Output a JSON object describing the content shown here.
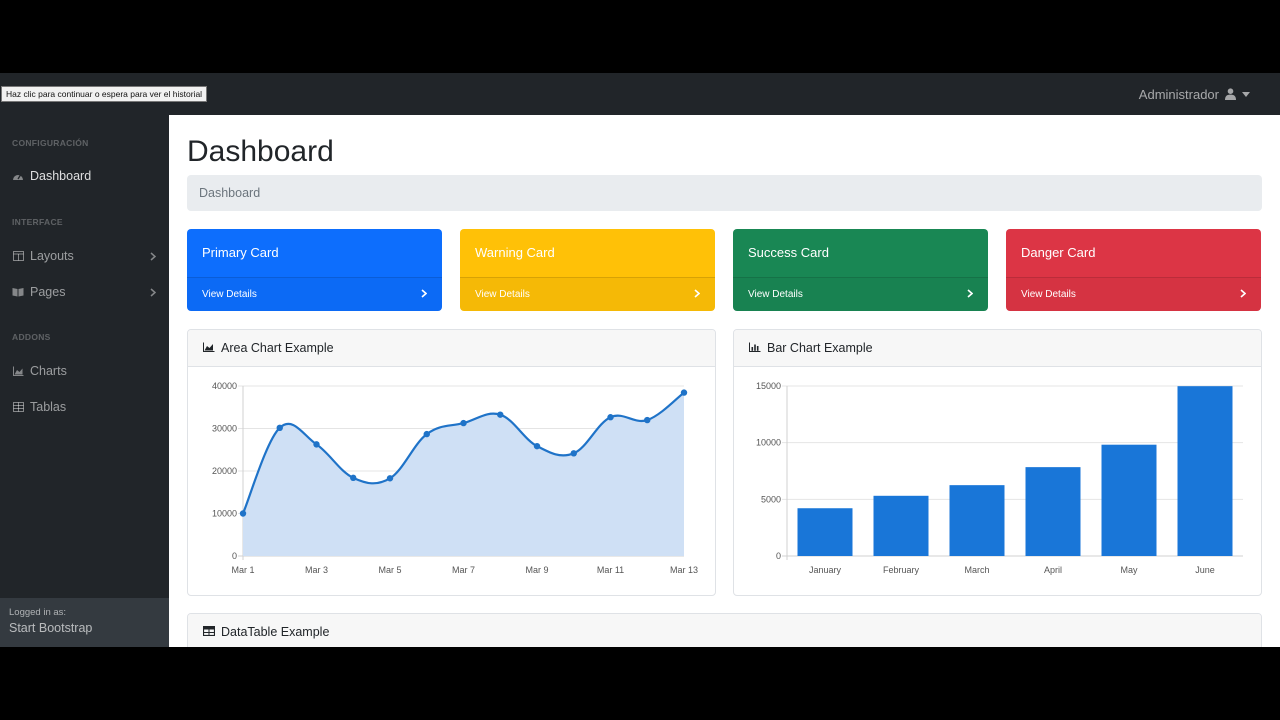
{
  "tooltip": "Haz clic para continuar o espera para ver el historial",
  "topnav": {
    "user_label": "Administrador"
  },
  "sidebar": {
    "sections": [
      {
        "heading": "CONFIGURACIÓN",
        "items": [
          {
            "label": "Dashboard",
            "icon": "tachometer-icon"
          }
        ]
      },
      {
        "heading": "INTERFACE",
        "items": [
          {
            "label": "Layouts",
            "icon": "columns-icon"
          },
          {
            "label": "Pages",
            "icon": "book-open-icon"
          }
        ]
      },
      {
        "heading": "ADDONS",
        "items": [
          {
            "label": "Charts",
            "icon": "area-chart-icon"
          },
          {
            "label": "Tablas",
            "icon": "table-icon"
          }
        ]
      }
    ],
    "footer": {
      "caption": "Logged in as:",
      "name": "Start Bootstrap"
    }
  },
  "main": {
    "title": "Dashboard",
    "breadcrumb": "Dashboard",
    "cards": [
      {
        "title": "Primary Card",
        "link": "View Details",
        "color": "#0d6efd"
      },
      {
        "title": "Warning Card",
        "link": "View Details",
        "color": "#ffc107"
      },
      {
        "title": "Success Card",
        "link": "View Details",
        "color": "#198754"
      },
      {
        "title": "Danger Card",
        "link": "View Details",
        "color": "#dc3545"
      }
    ],
    "area_panel_title": "Area Chart Example",
    "bar_panel_title": "Bar Chart Example",
    "table_panel_title": "DataTable Example"
  },
  "chart_data": [
    {
      "type": "area",
      "x": [
        "Mar 1",
        "Mar 2",
        "Mar 3",
        "Mar 4",
        "Mar 5",
        "Mar 6",
        "Mar 7",
        "Mar 8",
        "Mar 9",
        "Mar 10",
        "Mar 11",
        "Mar 12",
        "Mar 13"
      ],
      "x_tick_labels": [
        "Mar 1",
        "Mar 3",
        "Mar 5",
        "Mar 7",
        "Mar 9",
        "Mar 11",
        "Mar 13"
      ],
      "values": [
        10000,
        30162,
        26263,
        18394,
        18287,
        28682,
        31274,
        33259,
        25849,
        24159,
        32651,
        31984,
        38451
      ],
      "ylim": [
        0,
        40000
      ],
      "y_ticks": [
        0,
        10000,
        20000,
        30000,
        40000
      ],
      "grid": true,
      "line_color": "#1f73c8",
      "fill_color": "#cfe0f5"
    },
    {
      "type": "bar",
      "categories": [
        "January",
        "February",
        "March",
        "April",
        "May",
        "June"
      ],
      "values": [
        4215,
        5312,
        6251,
        7841,
        9821,
        14984
      ],
      "ylim": [
        0,
        15000
      ],
      "y_ticks": [
        0,
        5000,
        10000,
        15000
      ],
      "grid": true,
      "bar_color": "#1976d8"
    }
  ]
}
